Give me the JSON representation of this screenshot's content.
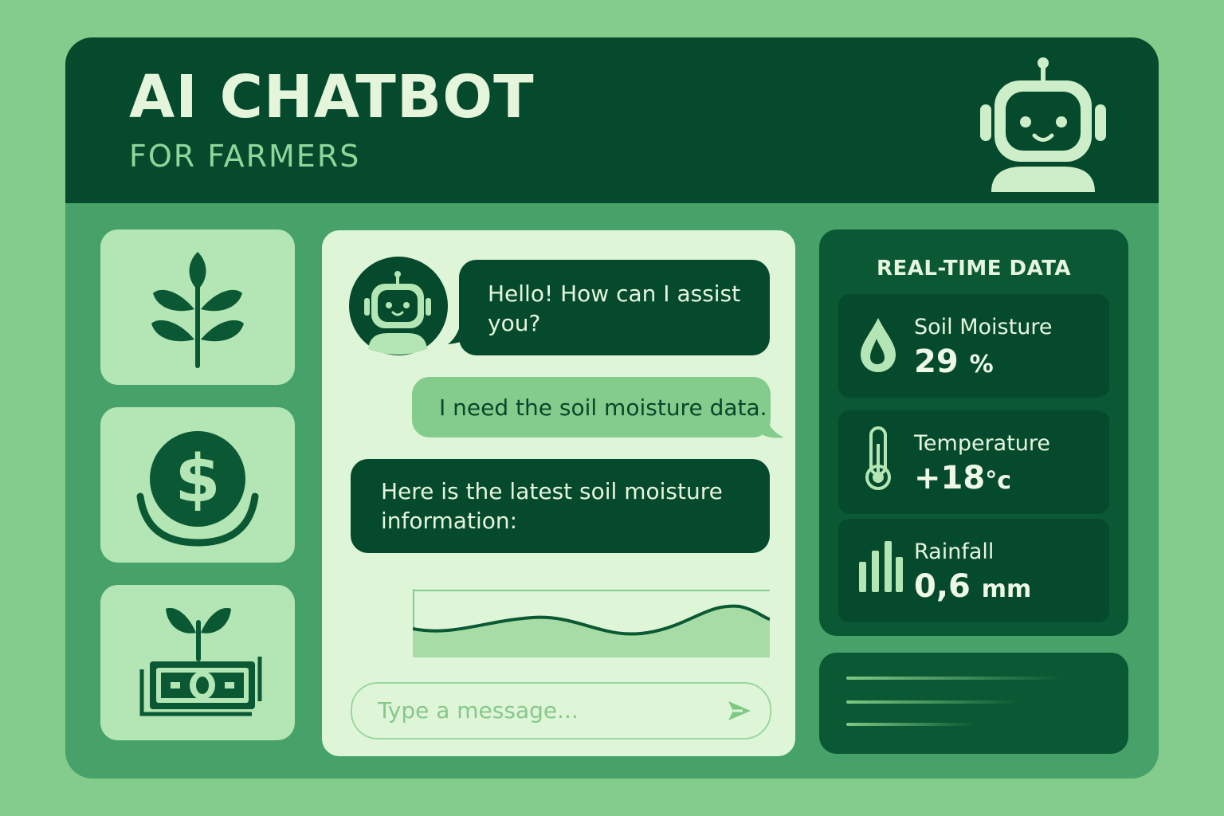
{
  "header": {
    "title": "AI CHATBOT",
    "subtitle": "FOR FARMERS",
    "logo_icon": "robot-icon"
  },
  "sidebar": {
    "tiles": [
      {
        "icon": "plant-icon"
      },
      {
        "icon": "dollar-coin-icon"
      },
      {
        "icon": "money-sprout-icon"
      }
    ]
  },
  "chat": {
    "messages": [
      {
        "sender": "bot",
        "text": "Hello!  How can I assist you?"
      },
      {
        "sender": "user",
        "text": "I need the soil moisture data."
      },
      {
        "sender": "bot",
        "text": "Here is the latest soil moisture information:"
      }
    ],
    "input": {
      "placeholder": "Type a message...",
      "value": ""
    },
    "send_icon": "send-arrow-icon"
  },
  "realtime": {
    "title": "REAL-TIME DATA",
    "cards": [
      {
        "label": "Soil Moisture",
        "value": "29",
        "unit": "%",
        "icon": "water-drop-icon"
      },
      {
        "label": "Temperature",
        "value": "+18",
        "unit": "°c",
        "icon": "thermometer-icon"
      },
      {
        "label": "Rainfall",
        "value": "0,6",
        "unit": "mm",
        "icon": "bar-chart-icon"
      }
    ]
  },
  "colors": {
    "background": "#84cc8c",
    "frame": "#47a26a",
    "header": "#054a2c",
    "dark_green": "#054a2c",
    "light_green": "#b4e5b4",
    "chat_bg": "#dff5d8",
    "accent_text": "#8ed69a"
  }
}
